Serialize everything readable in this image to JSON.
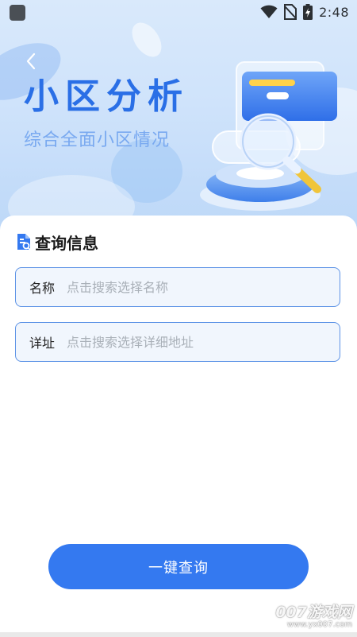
{
  "status_bar": {
    "time": "2:48",
    "icons": [
      "wifi-icon",
      "no-sim-icon",
      "battery-charging-icon"
    ]
  },
  "header": {
    "title": "小区分析",
    "subtitle": "综合全面小区情况",
    "back_icon": "chevron-left-icon"
  },
  "form": {
    "section_title": "查询信息",
    "section_icon": "document-search-icon",
    "name_field": {
      "label": "名称",
      "value": "",
      "placeholder": "点击搜索选择名称"
    },
    "address_field": {
      "label": "详址",
      "value": "",
      "placeholder": "点击搜索选择详细地址"
    },
    "submit_label": "一键查询"
  },
  "watermark": {
    "brand": "007游戏网",
    "url": "www.yx007.com"
  },
  "colors": {
    "accent": "#3479f0",
    "title_blue": "#2a6fe6",
    "subtitle_blue": "#79a9f0",
    "field_border": "#5d93e6",
    "field_bg": "#f1f6fd"
  }
}
